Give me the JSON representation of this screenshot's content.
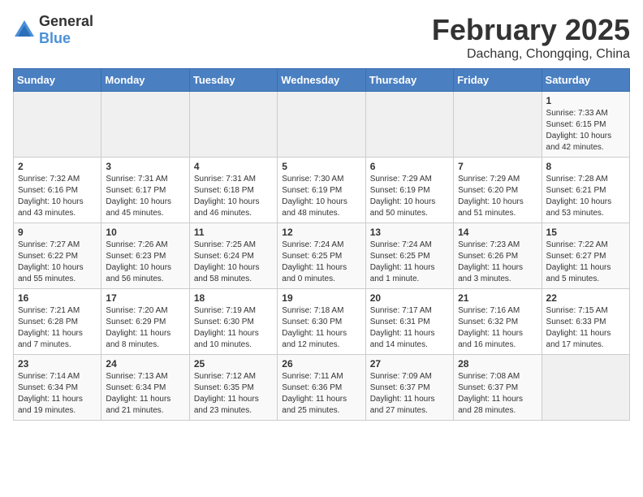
{
  "header": {
    "logo_general": "General",
    "logo_blue": "Blue",
    "main_title": "February 2025",
    "subtitle": "Dachang, Chongqing, China"
  },
  "days_of_week": [
    "Sunday",
    "Monday",
    "Tuesday",
    "Wednesday",
    "Thursday",
    "Friday",
    "Saturday"
  ],
  "weeks": [
    [
      {
        "day": "",
        "info": ""
      },
      {
        "day": "",
        "info": ""
      },
      {
        "day": "",
        "info": ""
      },
      {
        "day": "",
        "info": ""
      },
      {
        "day": "",
        "info": ""
      },
      {
        "day": "",
        "info": ""
      },
      {
        "day": "1",
        "info": "Sunrise: 7:33 AM\nSunset: 6:15 PM\nDaylight: 10 hours and 42 minutes."
      }
    ],
    [
      {
        "day": "2",
        "info": "Sunrise: 7:32 AM\nSunset: 6:16 PM\nDaylight: 10 hours and 43 minutes."
      },
      {
        "day": "3",
        "info": "Sunrise: 7:31 AM\nSunset: 6:17 PM\nDaylight: 10 hours and 45 minutes."
      },
      {
        "day": "4",
        "info": "Sunrise: 7:31 AM\nSunset: 6:18 PM\nDaylight: 10 hours and 46 minutes."
      },
      {
        "day": "5",
        "info": "Sunrise: 7:30 AM\nSunset: 6:19 PM\nDaylight: 10 hours and 48 minutes."
      },
      {
        "day": "6",
        "info": "Sunrise: 7:29 AM\nSunset: 6:19 PM\nDaylight: 10 hours and 50 minutes."
      },
      {
        "day": "7",
        "info": "Sunrise: 7:29 AM\nSunset: 6:20 PM\nDaylight: 10 hours and 51 minutes."
      },
      {
        "day": "8",
        "info": "Sunrise: 7:28 AM\nSunset: 6:21 PM\nDaylight: 10 hours and 53 minutes."
      }
    ],
    [
      {
        "day": "9",
        "info": "Sunrise: 7:27 AM\nSunset: 6:22 PM\nDaylight: 10 hours and 55 minutes."
      },
      {
        "day": "10",
        "info": "Sunrise: 7:26 AM\nSunset: 6:23 PM\nDaylight: 10 hours and 56 minutes."
      },
      {
        "day": "11",
        "info": "Sunrise: 7:25 AM\nSunset: 6:24 PM\nDaylight: 10 hours and 58 minutes."
      },
      {
        "day": "12",
        "info": "Sunrise: 7:24 AM\nSunset: 6:25 PM\nDaylight: 11 hours and 0 minutes."
      },
      {
        "day": "13",
        "info": "Sunrise: 7:24 AM\nSunset: 6:25 PM\nDaylight: 11 hours and 1 minute."
      },
      {
        "day": "14",
        "info": "Sunrise: 7:23 AM\nSunset: 6:26 PM\nDaylight: 11 hours and 3 minutes."
      },
      {
        "day": "15",
        "info": "Sunrise: 7:22 AM\nSunset: 6:27 PM\nDaylight: 11 hours and 5 minutes."
      }
    ],
    [
      {
        "day": "16",
        "info": "Sunrise: 7:21 AM\nSunset: 6:28 PM\nDaylight: 11 hours and 7 minutes."
      },
      {
        "day": "17",
        "info": "Sunrise: 7:20 AM\nSunset: 6:29 PM\nDaylight: 11 hours and 8 minutes."
      },
      {
        "day": "18",
        "info": "Sunrise: 7:19 AM\nSunset: 6:30 PM\nDaylight: 11 hours and 10 minutes."
      },
      {
        "day": "19",
        "info": "Sunrise: 7:18 AM\nSunset: 6:30 PM\nDaylight: 11 hours and 12 minutes."
      },
      {
        "day": "20",
        "info": "Sunrise: 7:17 AM\nSunset: 6:31 PM\nDaylight: 11 hours and 14 minutes."
      },
      {
        "day": "21",
        "info": "Sunrise: 7:16 AM\nSunset: 6:32 PM\nDaylight: 11 hours and 16 minutes."
      },
      {
        "day": "22",
        "info": "Sunrise: 7:15 AM\nSunset: 6:33 PM\nDaylight: 11 hours and 17 minutes."
      }
    ],
    [
      {
        "day": "23",
        "info": "Sunrise: 7:14 AM\nSunset: 6:34 PM\nDaylight: 11 hours and 19 minutes."
      },
      {
        "day": "24",
        "info": "Sunrise: 7:13 AM\nSunset: 6:34 PM\nDaylight: 11 hours and 21 minutes."
      },
      {
        "day": "25",
        "info": "Sunrise: 7:12 AM\nSunset: 6:35 PM\nDaylight: 11 hours and 23 minutes."
      },
      {
        "day": "26",
        "info": "Sunrise: 7:11 AM\nSunset: 6:36 PM\nDaylight: 11 hours and 25 minutes."
      },
      {
        "day": "27",
        "info": "Sunrise: 7:09 AM\nSunset: 6:37 PM\nDaylight: 11 hours and 27 minutes."
      },
      {
        "day": "28",
        "info": "Sunrise: 7:08 AM\nSunset: 6:37 PM\nDaylight: 11 hours and 28 minutes."
      },
      {
        "day": "",
        "info": ""
      }
    ]
  ]
}
